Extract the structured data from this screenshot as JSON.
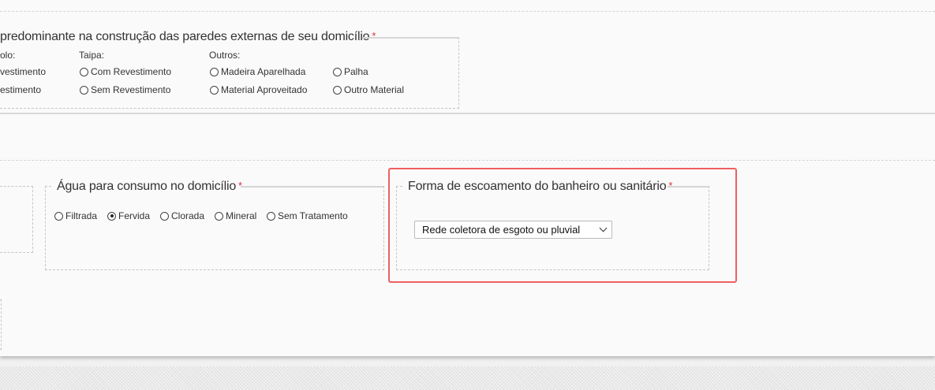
{
  "walls_section": {
    "legend": "predominante na construção das paredes externas de seu domicílio",
    "required_mark": "*",
    "groups": [
      {
        "heading": "olo:",
        "options": [
          "vestimento",
          "estimento"
        ]
      },
      {
        "heading": "Taipa:",
        "options": [
          "Com Revestimento",
          "Sem Revestimento"
        ]
      },
      {
        "heading": "Outros:",
        "options": [
          "Madeira Aparelhada",
          "Material Aproveitado"
        ]
      },
      {
        "heading": "",
        "options": [
          "Palha",
          "Outro Material"
        ]
      }
    ]
  },
  "water_section": {
    "legend": "Água para consumo no domicílio",
    "required_mark": "*",
    "options": [
      {
        "label": "Filtrada",
        "checked": false
      },
      {
        "label": "Fervida",
        "checked": true
      },
      {
        "label": "Clorada",
        "checked": false
      },
      {
        "label": "Mineral",
        "checked": false
      },
      {
        "label": "Sem Tratamento",
        "checked": false
      }
    ]
  },
  "sewage_section": {
    "legend": "Forma de escoamento do banheiro ou sanitário",
    "required_mark": "*",
    "selected_value": "Rede coletora de esgoto ou pluvial",
    "highlight_color": "#ee6060"
  },
  "colors": {
    "required": "#d9303b",
    "background": "#fafafa"
  }
}
